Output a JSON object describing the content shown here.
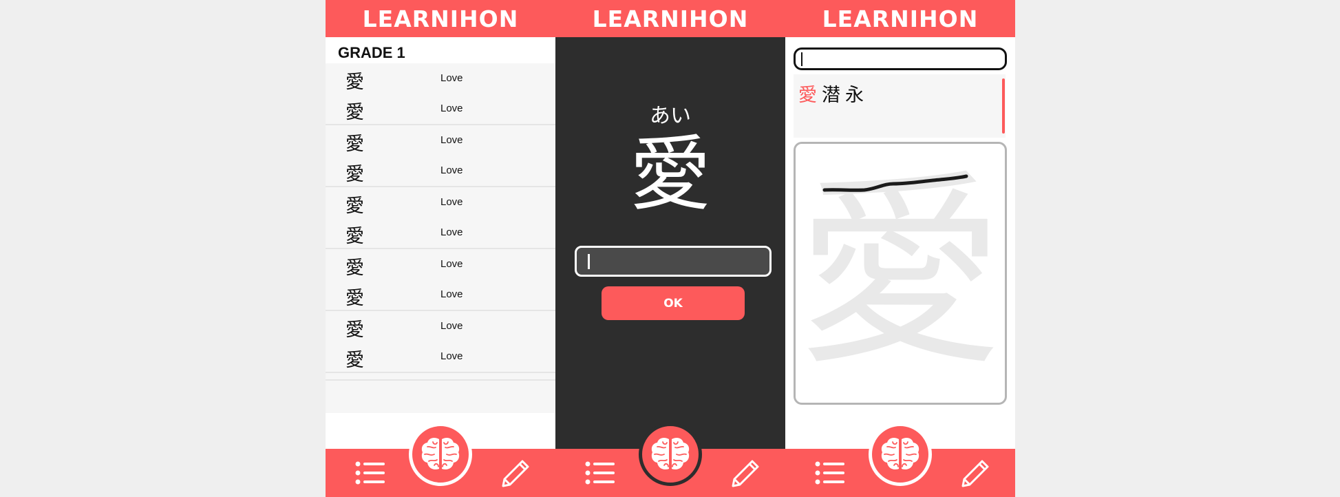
{
  "app": {
    "title": "LEARNIHON"
  },
  "list_screen": {
    "grade_label": "GRADE 1",
    "items": [
      {
        "kanji": "愛",
        "meaning": "Love"
      },
      {
        "kanji": "愛",
        "meaning": "Love"
      },
      {
        "kanji": "愛",
        "meaning": "Love"
      },
      {
        "kanji": "愛",
        "meaning": "Love"
      },
      {
        "kanji": "愛",
        "meaning": "Love"
      },
      {
        "kanji": "愛",
        "meaning": "Love"
      },
      {
        "kanji": "愛",
        "meaning": "Love"
      },
      {
        "kanji": "愛",
        "meaning": "Love"
      },
      {
        "kanji": "愛",
        "meaning": "Love"
      },
      {
        "kanji": "愛",
        "meaning": "Love"
      }
    ]
  },
  "quiz_screen": {
    "reading": "あい",
    "kanji": "愛",
    "answer_value": "",
    "ok_label": "OK"
  },
  "draw_screen": {
    "search_value": "",
    "suggestions": [
      "愛",
      "潜",
      "永"
    ],
    "ghost_kanji": "愛"
  },
  "nav": {
    "icons": [
      "list-icon",
      "brain-icon",
      "pencil-icon"
    ]
  },
  "colors": {
    "accent": "#fd5a5b",
    "dark": "#2d2d2d",
    "light_bg": "#f6f6f6"
  }
}
